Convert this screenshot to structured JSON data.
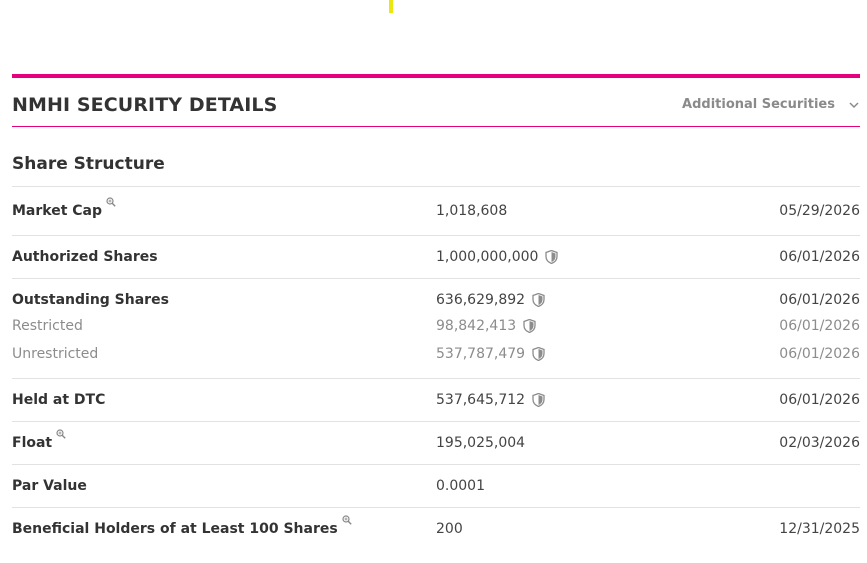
{
  "header": {
    "title": "NMHI SECURITY DETAILS",
    "additional_label": "Additional Securities",
    "accent_color": "#e5007d"
  },
  "section": {
    "title": "Share Structure"
  },
  "rows": {
    "market_cap": {
      "label": "Market Cap",
      "value": "1,018,608",
      "date": "05/29/2026",
      "icon": "magnifier-icon"
    },
    "authorized": {
      "label": "Authorized Shares",
      "value": "1,000,000,000",
      "date": "06/01/2026",
      "icon": "shield-icon"
    },
    "outstanding": {
      "label": "Outstanding Shares",
      "value": "636,629,892",
      "date": "06/01/2026",
      "icon": "shield-icon"
    },
    "restricted": {
      "label": "Restricted",
      "value": "98,842,413",
      "date": "06/01/2026",
      "icon": "shield-icon"
    },
    "unrestricted": {
      "label": "Unrestricted",
      "value": "537,787,479",
      "date": "06/01/2026",
      "icon": "shield-icon"
    },
    "held_dtc": {
      "label": "Held at DTC",
      "value": "537,645,712",
      "date": "06/01/2026",
      "icon": "shield-icon"
    },
    "float": {
      "label": "Float",
      "value": "195,025,004",
      "date": "02/03/2026",
      "icon": "magnifier-icon"
    },
    "par_value": {
      "label": "Par Value",
      "value": "0.0001",
      "date": ""
    },
    "beneficial": {
      "label": "Beneficial Holders of at Least 100 Shares",
      "value": "200",
      "date": "12/31/2025",
      "icon": "magnifier-icon"
    }
  }
}
